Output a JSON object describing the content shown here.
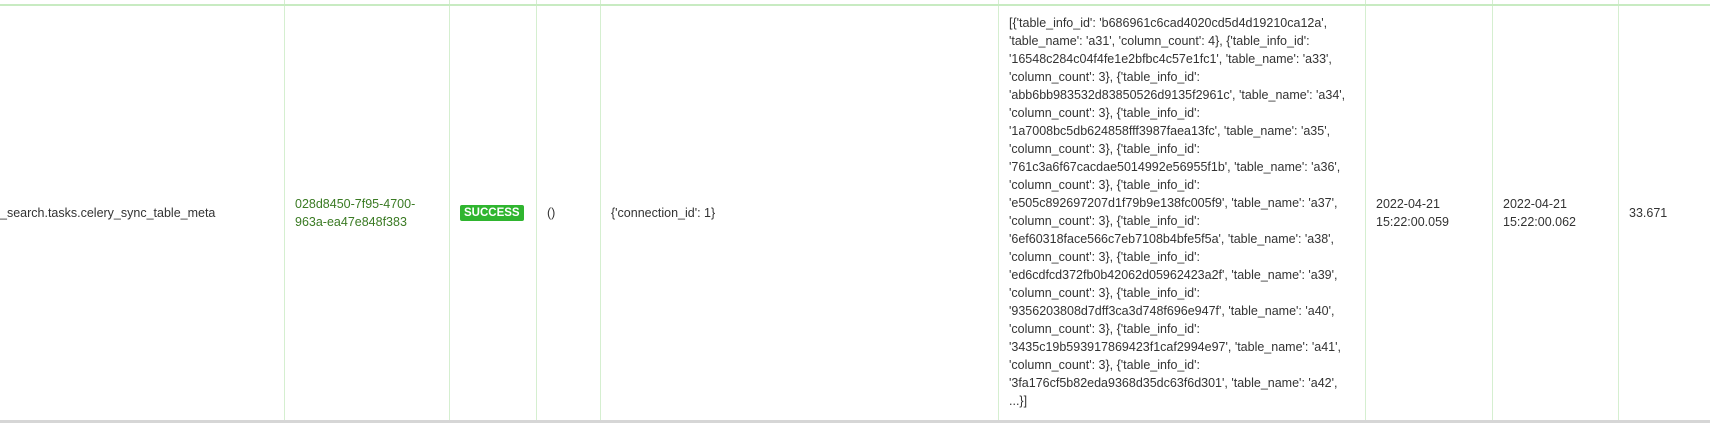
{
  "row": {
    "task_name": "_search.tasks.celery_sync_table_meta",
    "task_id": "028d8450-7f95-4700-963a-ea47e848f383",
    "status": "SUCCESS",
    "status_color": "#2fb52f",
    "args": "()",
    "kwargs": "{'connection_id': 1}",
    "result": "[{'table_info_id': 'b686961c6cad4020cd5d4d19210ca12a', 'table_name': 'a31', 'column_count': 4}, {'table_info_id': '16548c284c04f4fe1e2bfbc4c57e1fc1', 'table_name': 'a33', 'column_count': 3}, {'table_info_id': 'abb6bb983532d83850526d9135f2961c', 'table_name': 'a34', 'column_count': 3}, {'table_info_id': '1a7008bc5db624858fff3987faea13fc', 'table_name': 'a35', 'column_count': 3}, {'table_info_id': '761c3a6f67cacdae5014992e56955f1b', 'table_name': 'a36', 'column_count': 3}, {'table_info_id': 'e505c892697207d1f79b9e138fc005f9', 'table_name': 'a37', 'column_count': 3}, {'table_info_id': '6ef60318face566c7eb7108b4bfe5f5a', 'table_name': 'a38', 'column_count': 3}, {'table_info_id': 'ed6cdfcd372fb0b42062d05962423a2f', 'table_name': 'a39', 'column_count': 3}, {'table_info_id': '9356203808d7dff3ca3d748f696e947f', 'table_name': 'a40', 'column_count': 3}, {'table_info_id': '3435c19b593917869423f1caf2994e97', 'table_name': 'a41', 'column_count': 3}, {'table_info_id': '3fa176cf5b82eda9368d35dc63f6d301', 'table_name': 'a42', ...}]",
    "date_received": "2022-04-21 15:22:00.059",
    "date_done": "2022-04-21 15:22:00.062",
    "runtime": "33.671"
  }
}
